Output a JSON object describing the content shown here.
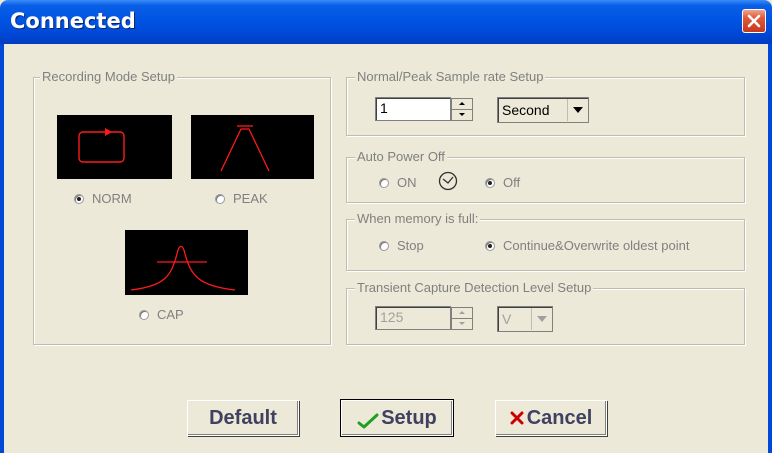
{
  "window": {
    "title": "Connected"
  },
  "recording_mode": {
    "legend": "Recording  Mode Setup",
    "options": [
      {
        "label": "NORM",
        "selected": true
      },
      {
        "label": "PEAK",
        "selected": false
      },
      {
        "label": "CAP",
        "selected": false
      }
    ]
  },
  "sample_rate": {
    "legend": "Normal/Peak Sample rate Setup",
    "value": "1",
    "unit": "Second"
  },
  "auto_power_off": {
    "legend": "Auto Power Off",
    "options": [
      {
        "label": "ON",
        "selected": false
      },
      {
        "label": "Off",
        "selected": true
      }
    ],
    "icon": "clock-icon"
  },
  "memory_full": {
    "legend": "When memory is full:",
    "options": [
      {
        "label": "Stop",
        "selected": false
      },
      {
        "label": "Continue&Overwrite oldest point",
        "selected": true
      }
    ]
  },
  "transient": {
    "legend": "Transient Capture Detection Level Setup",
    "value": "125",
    "unit": "V"
  },
  "buttons": {
    "default": "Default",
    "setup": "Setup",
    "cancel": "Cancel"
  },
  "colors": {
    "titlebar": "#0054e3",
    "dialog_bg": "#ece9d8",
    "waveform": "#ff1a1a",
    "check": "#20a020",
    "x_mark": "#cc0000"
  }
}
